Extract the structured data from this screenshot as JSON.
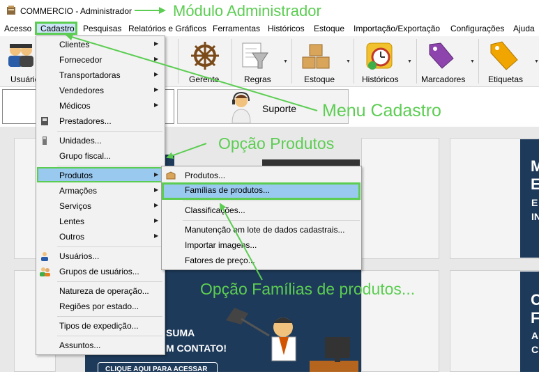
{
  "window": {
    "title": "COMMERCIO - Administrador"
  },
  "menubar": {
    "items": [
      "Acesso",
      "Cadastro",
      "Pesquisas",
      "Relatórios e Gráficos",
      "Ferramentas",
      "Históricos",
      "Estoque",
      "Importação/Exportação",
      "Configurações",
      "Ajuda"
    ]
  },
  "toolbar": {
    "items": [
      "Usuários",
      "Gerente",
      "Regras",
      "Estoque",
      "Históricos",
      "Marcadores",
      "Etiquetas"
    ]
  },
  "tabs": {
    "suporte": "Suporte"
  },
  "cadastro_menu": {
    "items": [
      "Clientes",
      "Fornecedor",
      "Transportadoras",
      "Vendedores",
      "Médicos",
      "Prestadores...",
      "Unidades...",
      "Grupo fiscal...",
      "Produtos",
      "Armações",
      "Serviços",
      "Lentes",
      "Outros",
      "Usuários...",
      "Grupos de usuários...",
      "Natureza de operação...",
      "Regiões por estado...",
      "Tipos de expedição...",
      "Assuntos..."
    ]
  },
  "produtos_submenu": {
    "items": [
      "Produtos...",
      "Famílias de produtos...",
      "Classificações...",
      "Manutenção em lote de dados cadastrais...",
      "Importar imagens...",
      "Fatores de preço..."
    ]
  },
  "annotations": {
    "modulo": "Módulo Administrador",
    "menu_cadastro": "Menu Cadastro",
    "opcao_produtos": "Opção Produtos",
    "opcao_familias": "Opção Famílias de produtos..."
  },
  "banner": {
    "fragment_1": "SUMA",
    "fragment_2": "M CONTATO!",
    "button": "CLIQUE AQUI PARA ACESSAR",
    "right_top_1": "M",
    "right_top_2": "E",
    "right_top_3": "E",
    "right_top_4": "IN",
    "right_bot_1": "C",
    "right_bot_2": "F",
    "right_bot_3": "A",
    "right_bot_4": "C"
  },
  "colors": {
    "annotation": "#5ccd52",
    "highlight": "#99c9ef",
    "navy": "#1e3a5a"
  }
}
